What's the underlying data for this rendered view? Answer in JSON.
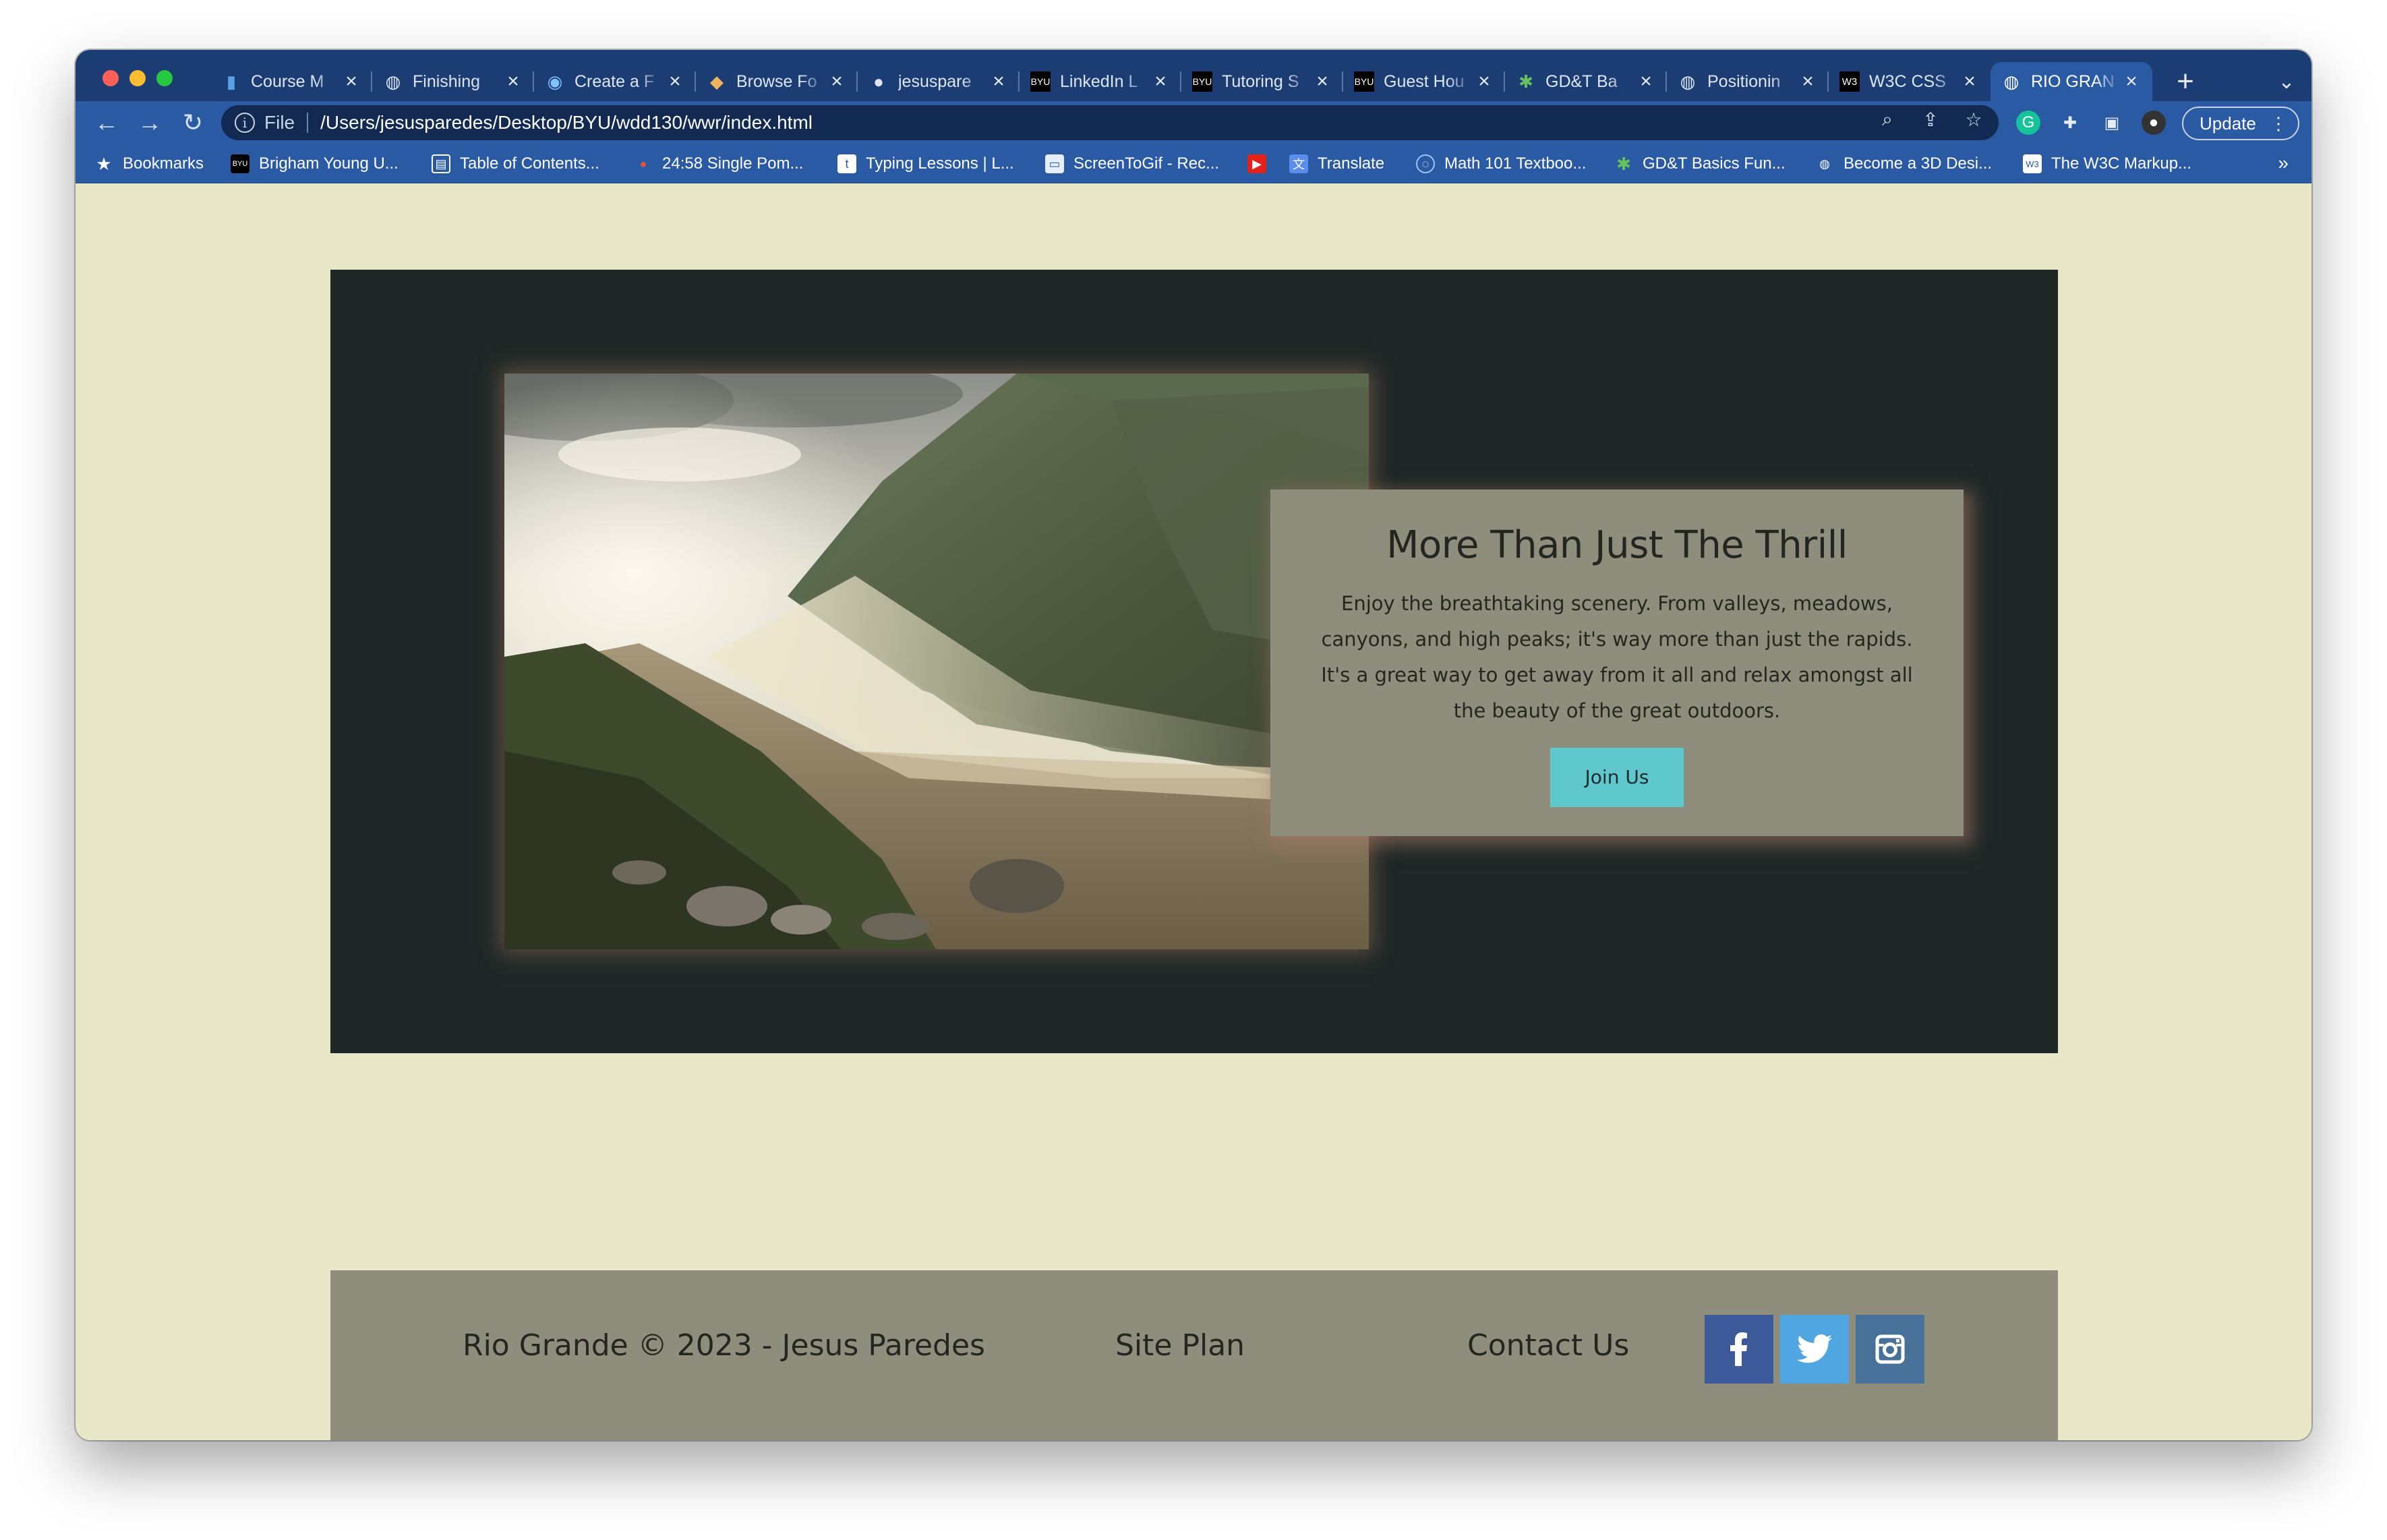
{
  "browser": {
    "tabs": [
      {
        "title": "Course M",
        "icon": "bar-chart-icon"
      },
      {
        "title": "Finishing",
        "icon": "globe-icon"
      },
      {
        "title": "Create a F",
        "icon": "c-logo-icon"
      },
      {
        "title": "Browse Fo",
        "icon": "colorful-logo-icon"
      },
      {
        "title": "jesuspare",
        "icon": "github-icon"
      },
      {
        "title": "LinkedIn L",
        "icon": "byu-icon"
      },
      {
        "title": "Tutoring S",
        "icon": "byu-icon"
      },
      {
        "title": "Guest Hou",
        "icon": "byu-icon"
      },
      {
        "title": "GD&T Ba",
        "icon": "gear-icon"
      },
      {
        "title": "Positionin",
        "icon": "globe-icon"
      },
      {
        "title": "W3C CSS",
        "icon": "w3c-icon"
      },
      {
        "title": "RIO GRAN",
        "icon": "globe-icon",
        "active": true
      }
    ],
    "address": {
      "scheme": "File",
      "url": "/Users/jesusparedes/Desktop/BYU/wdd130/wwr/index.html"
    },
    "update_label": "Update",
    "bookmarks": [
      {
        "label": "Bookmarks",
        "icon": "star-icon"
      },
      {
        "label": "Brigham Young U...",
        "icon": "byu-icon"
      },
      {
        "label": "Table of Contents...",
        "icon": "book-icon"
      },
      {
        "label": "24:58 Single Pom...",
        "icon": "tomato-icon"
      },
      {
        "label": "Typing Lessons | L...",
        "icon": "typing-icon"
      },
      {
        "label": "ScreenToGif - Rec...",
        "icon": "screen-icon"
      },
      {
        "label": "",
        "icon": "youtube-icon"
      },
      {
        "label": "Translate",
        "icon": "translate-icon"
      },
      {
        "label": "Math 101 Textboo...",
        "icon": "circle-logo-icon"
      },
      {
        "label": "GD&T Basics Fun...",
        "icon": "gear-icon"
      },
      {
        "label": "Become a 3D Desi...",
        "icon": "globe-icon"
      },
      {
        "label": "The W3C Markup...",
        "icon": "w3c-icon"
      }
    ]
  },
  "hero": {
    "heading": "More Than Just The Thrill",
    "body": "Enjoy the breathtaking scenery. From valleys, meadows, canyons, and high peaks; it's way more than just the rapids. It's a great way to get away from it all and relax amongst all the beauty of the great outdoors.",
    "button": "Join Us"
  },
  "footer": {
    "copyright": "Rio Grande © 2023 - Jesus Paredes",
    "site_plan": "Site Plan",
    "contact": "Contact Us",
    "social": [
      "facebook-icon",
      "twitter-icon",
      "instagram-icon"
    ]
  },
  "colors": {
    "page_bg": "#e8e7c8",
    "hero_bg": "#1f2826",
    "card_bg": "#8f8e7d",
    "button": "#5ec8cd",
    "browser_chrome": "#2a5aa3"
  }
}
